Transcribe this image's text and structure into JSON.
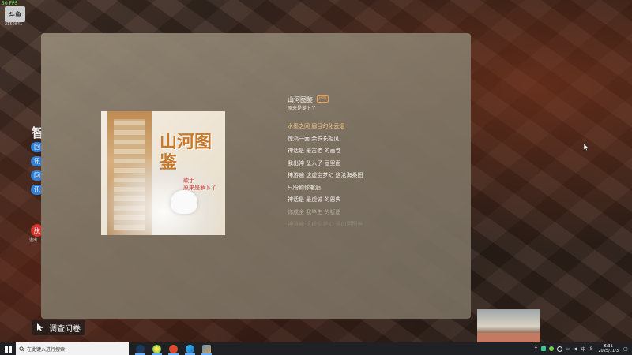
{
  "overlay": {
    "fps": "50 FPS",
    "stream_logo": "斗鱼",
    "stream_id": "2150641"
  },
  "background_ui": {
    "title_char": "智",
    "pills": [
      "回",
      "讯",
      "回",
      "讯"
    ],
    "red_button": "脱",
    "red_caption": "退出"
  },
  "player": {
    "song_title": "山河图鉴",
    "badge": "HiFi",
    "artist": "原来是萝卜丫",
    "lyrics": [
      {
        "text": "水墨之间 眉目幻化云烟",
        "state": "hl"
      },
      {
        "text": "惊鸿一面 余岁长相见",
        "state": "normal"
      },
      {
        "text": "神话是 最古老 的画卷",
        "state": "normal"
      },
      {
        "text": "我出神 坠入了 画里面",
        "state": "normal"
      },
      {
        "text": "神游遍 这虚空梦幻 这沧海桑田",
        "state": "normal"
      },
      {
        "text": "只盼和你邂逅",
        "state": "normal"
      },
      {
        "text": "神话是 最虔诚 的恩典",
        "state": "normal"
      },
      {
        "text": "你成全 我毕生 的祈愿",
        "state": "fade1"
      },
      {
        "text": "神游遍 这虚空梦幻 这山河图鉴",
        "state": "fade2"
      }
    ],
    "cover": {
      "title": "山河图鉴",
      "singer_line1": "歌手",
      "singer_line2": "原来是萝卜丫"
    }
  },
  "survey": {
    "label": "调查问卷"
  },
  "taskbar": {
    "search_placeholder": "在此键入进行搜索",
    "apps": [
      "steam",
      "browser",
      "game",
      "edge",
      "app"
    ],
    "tray_lang": "中",
    "time": "6:31",
    "date": "2025/11/3"
  },
  "colors": {
    "accent": "#2f7fd6",
    "highlight_lyric": "#f3c98a",
    "badge": "#f0a050",
    "taskbar": "#1f2124"
  }
}
